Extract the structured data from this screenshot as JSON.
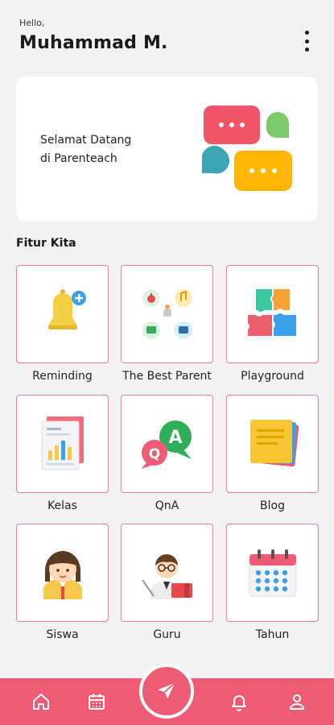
{
  "header": {
    "greeting": "Hello,",
    "username": "Muhammad M."
  },
  "welcome": {
    "line1": "Selamat Datang",
    "line2": "di Parenteach"
  },
  "section": {
    "title": "Fitur Kita"
  },
  "features": [
    {
      "label": "Reminding",
      "icon": "bell-icon"
    },
    {
      "label": "The Best Parent",
      "icon": "parent-apps-icon"
    },
    {
      "label": "Playground",
      "icon": "puzzle-icon"
    },
    {
      "label": "Kelas",
      "icon": "report-icon"
    },
    {
      "label": "QnA",
      "icon": "qna-icon"
    },
    {
      "label": "Blog",
      "icon": "notes-icon"
    },
    {
      "label": "Siswa",
      "icon": "student-icon"
    },
    {
      "label": "Guru",
      "icon": "teacher-icon"
    },
    {
      "label": "Tahun",
      "icon": "calendar-icon"
    }
  ],
  "colors": {
    "accent": "#ef5b74",
    "tile_border": "#f07a8d",
    "background": "#f2f2f4"
  },
  "nav": [
    "home-icon",
    "calendar-icon",
    "send-icon",
    "bell-icon",
    "user-icon"
  ]
}
